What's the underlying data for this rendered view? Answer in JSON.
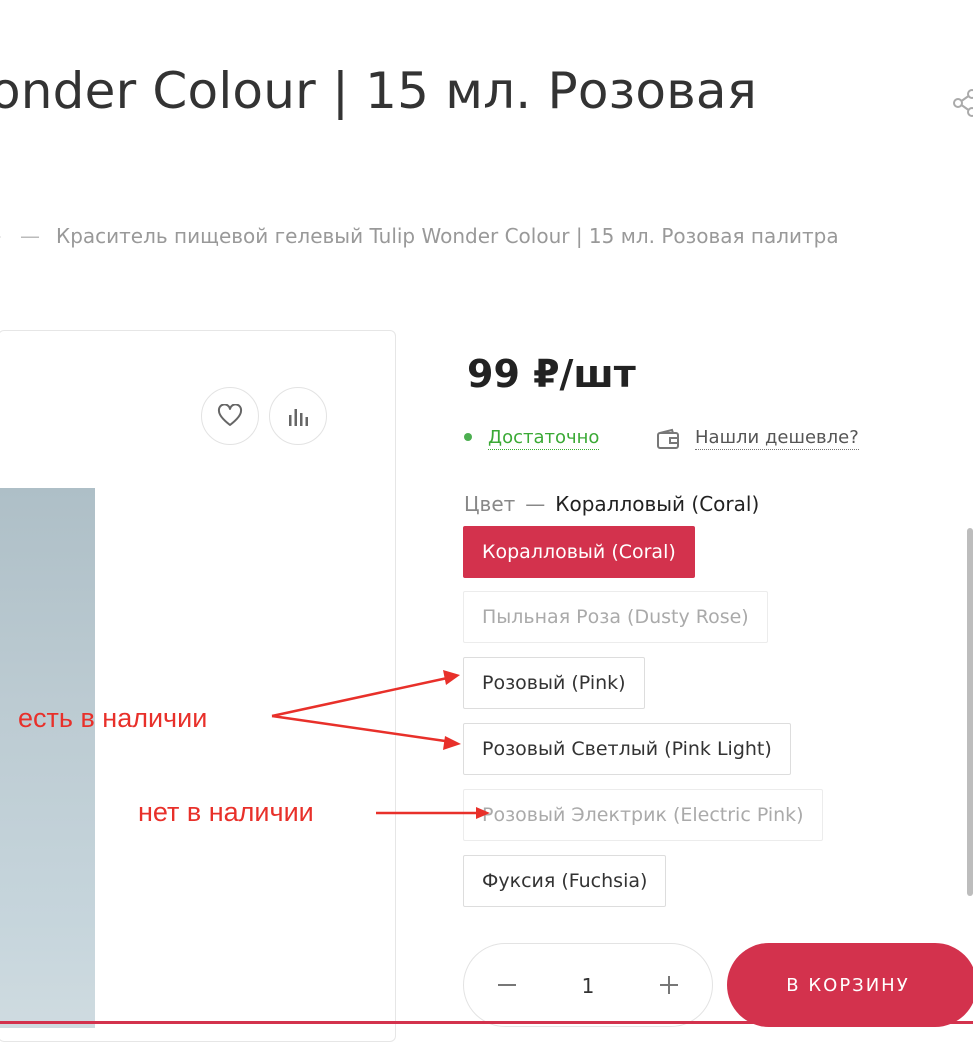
{
  "product": {
    "title": "onder Colour | 15 мл. Розовая",
    "breadcrumb_chevron": "›",
    "breadcrumb_separator": "—",
    "breadcrumb_current": "Краситель пищевой гелевый Tulip Wonder Colour | 15 мл. Розовая палитра",
    "price": "99 ₽/шт",
    "stock": "Достаточно",
    "cheaper_link": "Нашли дешевле?",
    "color_label": "Цвет",
    "color_separator": "—",
    "color_value": "Коралловый (Coral)",
    "options": [
      {
        "label": "Коралловый (Coral)",
        "state": "selected"
      },
      {
        "label": "Пыльная Роза (Dusty Rose)",
        "state": "unavailable"
      },
      {
        "label": "Розовый (Pink)",
        "state": "available"
      },
      {
        "label": "Розовый Светлый (Pink Light)",
        "state": "available"
      },
      {
        "label": "Розовый Электрик (Electric Pink)",
        "state": "unavailable"
      },
      {
        "label": "Фуксия (Fuchsia)",
        "state": "available"
      }
    ],
    "quantity": "1",
    "cart_button": "В КОРЗИНУ"
  },
  "annotations": {
    "in_stock": "есть в наличии",
    "out_of_stock": "нет в наличии",
    "color": "#e8302a"
  },
  "colors": {
    "accent": "#d3324d",
    "stock_green": "#3aa935"
  },
  "icons": [
    "share-icon",
    "heart-icon",
    "compare-icon",
    "wallet-icon",
    "minus-icon",
    "plus-icon"
  ]
}
